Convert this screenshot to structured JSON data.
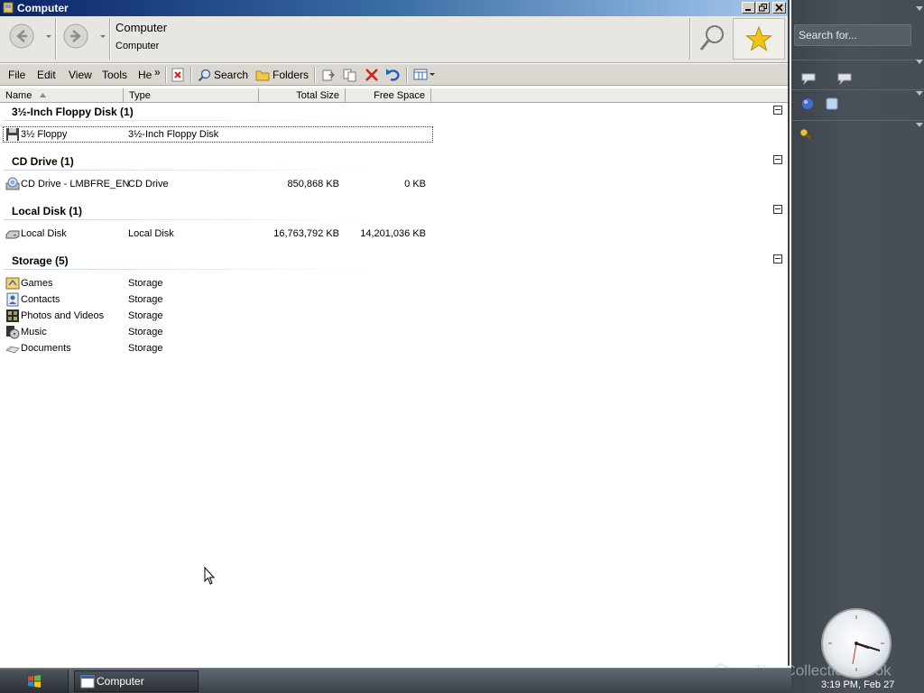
{
  "window": {
    "title": "Computer",
    "minimize_label": "Minimize",
    "restore_label": "Restore",
    "close_label": "Close"
  },
  "navbar": {
    "title": "Computer",
    "subtitle": "Computer"
  },
  "menubar": {
    "file": "File",
    "edit": "Edit",
    "view": "View",
    "tools": "Tools",
    "help": "He",
    "overflow": "»",
    "search": "Search",
    "folders": "Folders"
  },
  "columns": {
    "name": "Name",
    "type": "Type",
    "total": "Total Size",
    "free": "Free Space"
  },
  "groups": [
    {
      "title": "3½-Inch Floppy Disk (1)",
      "items": [
        {
          "name": "3½ Floppy",
          "type": "3½-Inch Floppy Disk",
          "total": "",
          "free": "",
          "icon": "floppy-icon",
          "selected": true
        }
      ]
    },
    {
      "title": "CD Drive (1)",
      "items": [
        {
          "name": "CD Drive - LMBFRE_EN",
          "type": "CD Drive",
          "total": "850,868 KB",
          "free": "0 KB",
          "icon": "cd-drive-icon"
        }
      ]
    },
    {
      "title": "Local Disk (1)",
      "items": [
        {
          "name": "Local Disk",
          "type": "Local Disk",
          "total": "16,763,792 KB",
          "free": "14,201,036 KB",
          "icon": "hard-disk-icon"
        }
      ]
    },
    {
      "title": "Storage (5)",
      "items": [
        {
          "name": "Games",
          "type": "Storage",
          "total": "",
          "free": "",
          "icon": "games-icon"
        },
        {
          "name": "Contacts",
          "type": "Storage",
          "total": "",
          "free": "",
          "icon": "contacts-icon"
        },
        {
          "name": "Photos and Videos",
          "type": "Storage",
          "total": "",
          "free": "",
          "icon": "photos-icon"
        },
        {
          "name": "Music",
          "type": "Storage",
          "total": "",
          "free": "",
          "icon": "music-icon"
        },
        {
          "name": "Documents",
          "type": "Storage",
          "total": "",
          "free": "",
          "icon": "documents-icon"
        }
      ]
    }
  ],
  "sidebar": {
    "search_placeholder": "Search for...",
    "time": "3:19 PM, Feb 27",
    "watermark": "The Collection Book"
  },
  "taskbar": {
    "task_label": "Computer"
  },
  "colors": {
    "titlebar_start": "#0a246a",
    "sidebar": "#4a5058",
    "taskbar": "#3b4148"
  }
}
